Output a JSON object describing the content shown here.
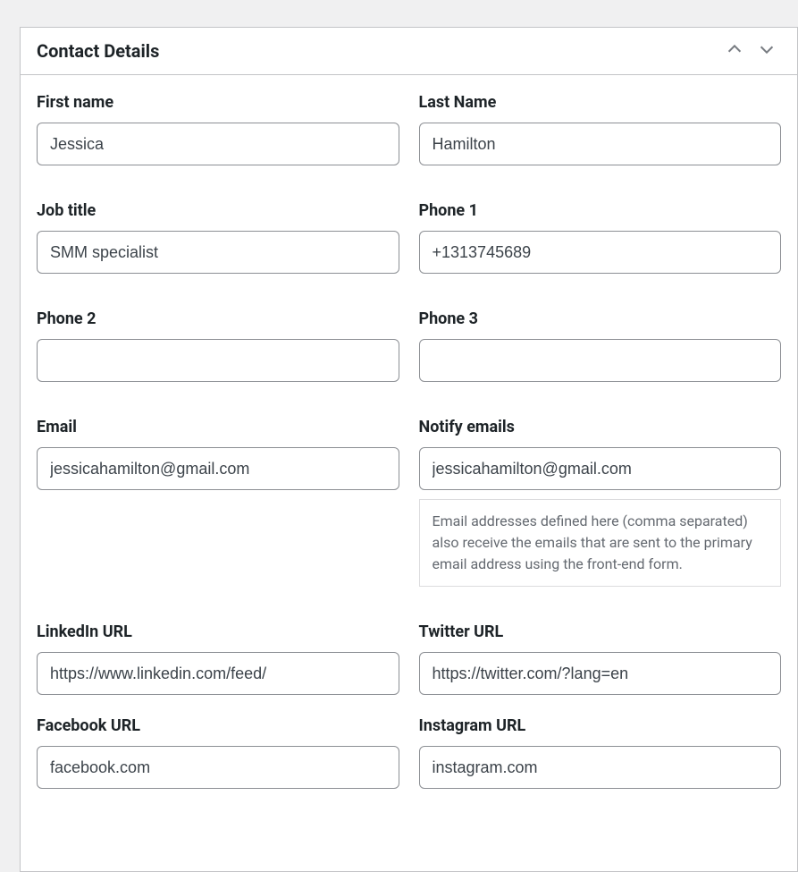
{
  "panel": {
    "title": "Contact Details"
  },
  "fields": {
    "first_name": {
      "label": "First name",
      "value": "Jessica"
    },
    "last_name": {
      "label": "Last Name",
      "value": "Hamilton"
    },
    "job_title": {
      "label": "Job title",
      "value": "SMM specialist"
    },
    "phone1": {
      "label": "Phone 1",
      "value": "+1313745689"
    },
    "phone2": {
      "label": "Phone 2",
      "value": ""
    },
    "phone3": {
      "label": "Phone 3",
      "value": ""
    },
    "email": {
      "label": "Email",
      "value": "jessicahamilton@gmail.com"
    },
    "notify_emails": {
      "label": "Notify emails",
      "value": "jessicahamilton@gmail.com",
      "help": "Email addresses defined here (comma separated) also receive the emails that are sent to the primary email address using the front-end form."
    },
    "linkedin_url": {
      "label": "LinkedIn URL",
      "value": "https://www.linkedin.com/feed/"
    },
    "twitter_url": {
      "label": "Twitter URL",
      "value": "https://twitter.com/?lang=en"
    },
    "facebook_url": {
      "label": "Facebook URL",
      "value": "facebook.com"
    },
    "instagram_url": {
      "label": "Instagram URL",
      "value": "instagram.com"
    }
  }
}
